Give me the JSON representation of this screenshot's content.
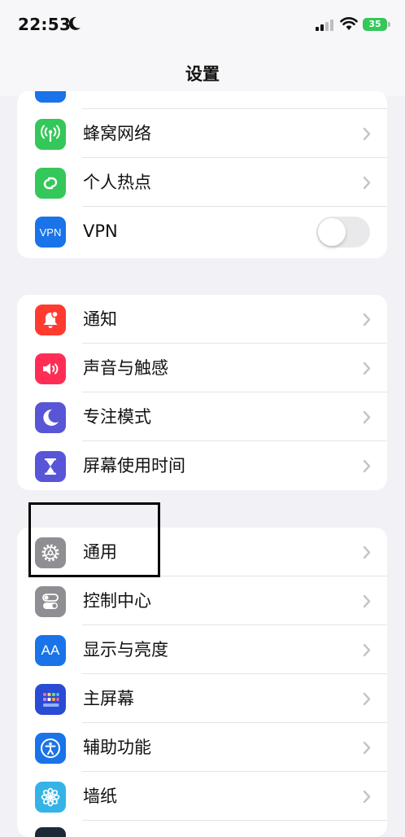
{
  "status_bar": {
    "time": "22:53",
    "battery": "35"
  },
  "nav": {
    "title": "设置"
  },
  "group1": [
    {
      "label": "蜂窝网络",
      "icon": "cellular-antenna-icon",
      "color": "#34c759"
    },
    {
      "label": "个人热点",
      "icon": "hotspot-chain-icon",
      "color": "#34c759"
    },
    {
      "label": "VPN",
      "icon": "vpn-icon",
      "icon_text": "VPN",
      "color": "#1a73e8",
      "toggle": false
    }
  ],
  "group2": [
    {
      "label": "通知",
      "icon": "bell-icon",
      "color": "#ff3b30"
    },
    {
      "label": "声音与触感",
      "icon": "speaker-icon",
      "color": "#ff2d55"
    },
    {
      "label": "专注模式",
      "icon": "moon-icon",
      "color": "#5856d6"
    },
    {
      "label": "屏幕使用时间",
      "icon": "hourglass-icon",
      "color": "#5856d6"
    }
  ],
  "group3": [
    {
      "label": "通用",
      "icon": "gear-icon",
      "color": "#8e8e93"
    },
    {
      "label": "控制中心",
      "icon": "control-toggles-icon",
      "color": "#8e8e93"
    },
    {
      "label": "显示与亮度",
      "icon": "text-size-icon",
      "icon_text": "AA",
      "color": "#1a73e8"
    },
    {
      "label": "主屏幕",
      "icon": "home-grid-icon",
      "color": "#2a4bd4"
    },
    {
      "label": "辅助功能",
      "icon": "accessibility-icon",
      "color": "#1a73e8"
    },
    {
      "label": "墙纸",
      "icon": "flower-icon",
      "color": "#36b3e6"
    }
  ]
}
